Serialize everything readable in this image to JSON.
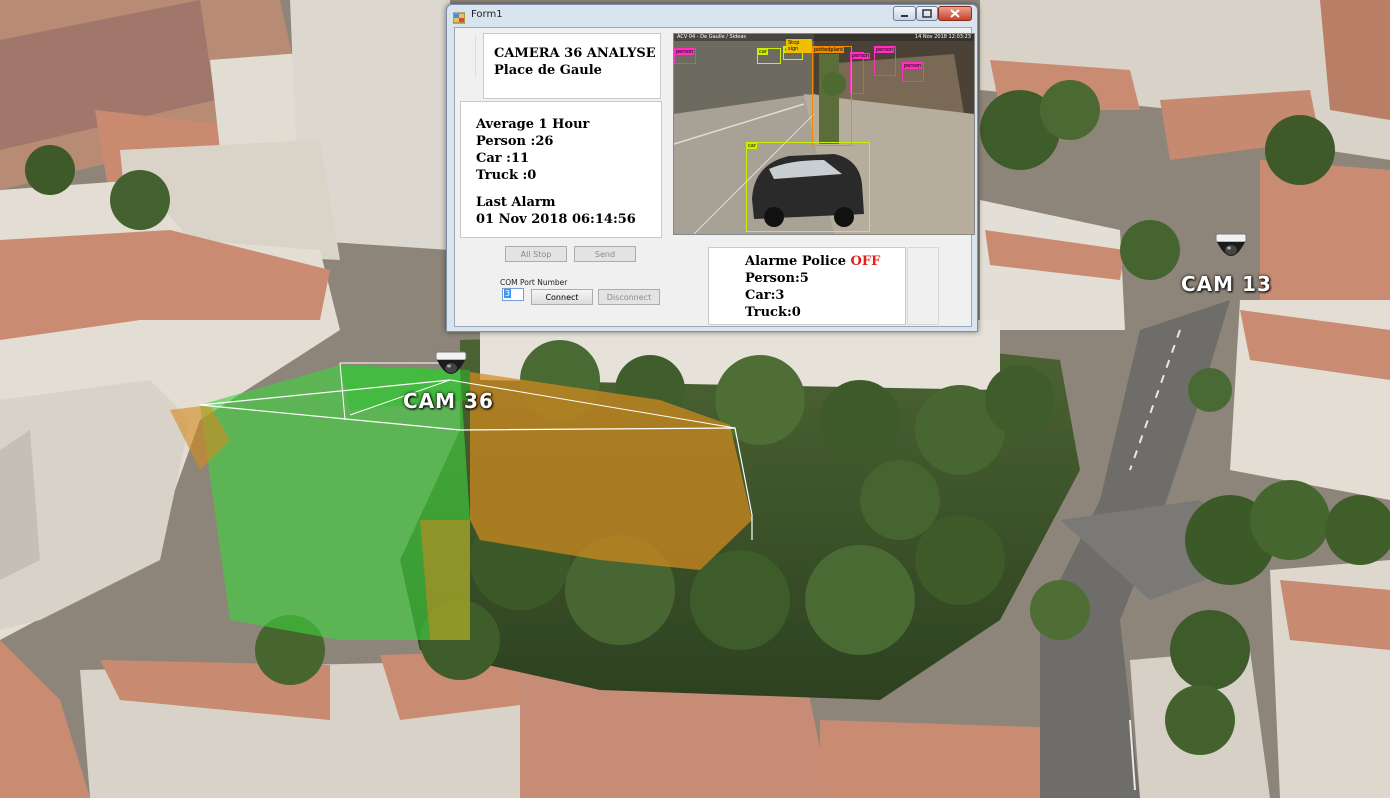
{
  "scene": {
    "cam36_label": "CAM 36",
    "cam13_label": "CAM 13"
  },
  "window": {
    "title": "Form1",
    "panel_camera": {
      "title": "CAMERA 36 ANALYSE",
      "location": "Place de Gaule"
    },
    "panel_stats": {
      "heading": "Average 1 Hour",
      "person": "Person :26",
      "car": "Car  :11",
      "truck": "Truck :0",
      "alarm_heading": "Last Alarm",
      "alarm_time": "01 Nov 2018 06:14:56"
    },
    "feed": {
      "overlay_left": "ACV 04 - De Gaulle / Sideas",
      "overlay_right": "14 Nov 2018  12:03:23",
      "detections": [
        "person",
        "car",
        "car",
        "Stop sign",
        "pottedplant",
        "person",
        "person",
        "person",
        "car"
      ]
    },
    "buttons": {
      "all_stop": "All Stop",
      "send": "Send",
      "connect": "Connect",
      "disconnect": "Disconnect"
    },
    "com_port": {
      "label": "COM Port Number",
      "value": "3"
    },
    "panel_alarm": {
      "label": "Alarme Police ",
      "status": "OFF",
      "status_color": "#e0201a",
      "person": "Person:5",
      "car": "Car:3",
      "truck": "Truck:0"
    }
  }
}
